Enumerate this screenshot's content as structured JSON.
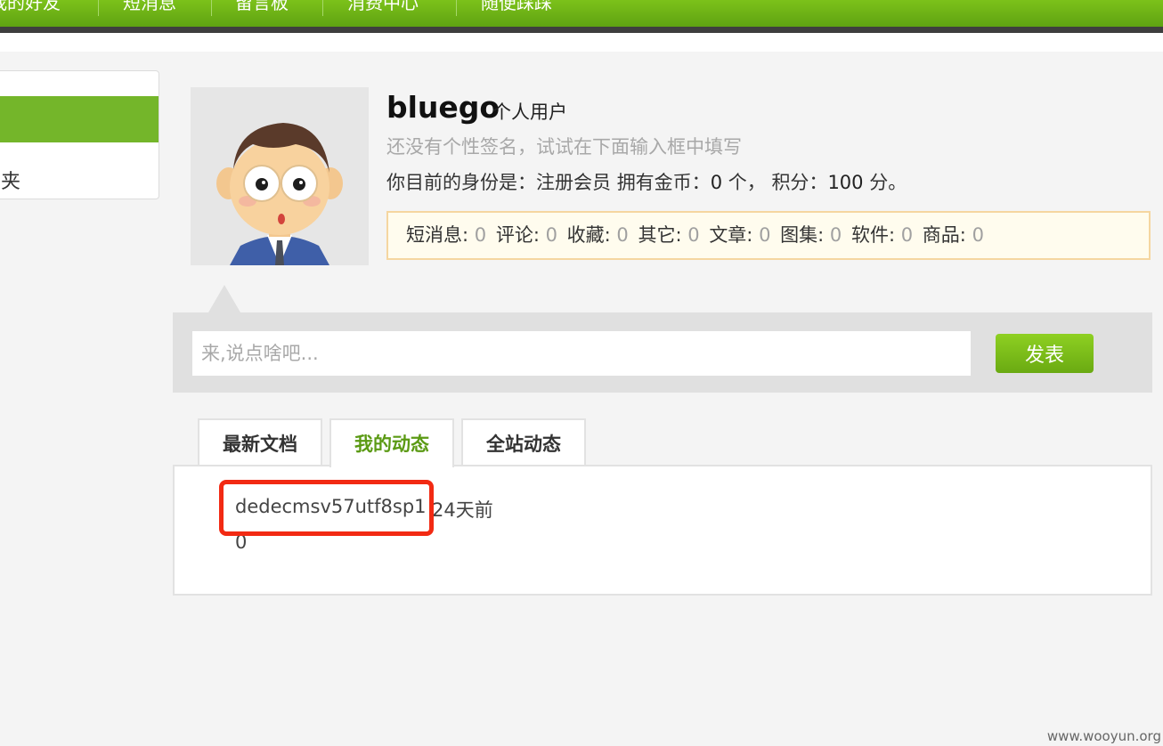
{
  "topnav": {
    "items": [
      "我的好友",
      "短消息",
      "留言板",
      "消费中心",
      "随便踩踩"
    ]
  },
  "sidebar": {
    "partial_label": "夹"
  },
  "profile": {
    "username": "bluego",
    "user_type": "个人用户",
    "signature": "还没有个性签名，试试在下面输入框中填写",
    "identity_prefix": "你目前的身份是：",
    "identity_role": "注册会员",
    "coins_label": "拥有金币：",
    "coins_value": "0",
    "coins_unit": "个，",
    "points_label": "积分：",
    "points_value": "100",
    "points_unit": "分。"
  },
  "stats": [
    {
      "label": "短消息:",
      "value": "0"
    },
    {
      "label": "评论:",
      "value": "0"
    },
    {
      "label": "收藏:",
      "value": "0"
    },
    {
      "label": "其它:",
      "value": "0"
    },
    {
      "label": "文章:",
      "value": "0"
    },
    {
      "label": "图集:",
      "value": "0"
    },
    {
      "label": "软件:",
      "value": "0"
    },
    {
      "label": "商品:",
      "value": "0"
    }
  ],
  "post": {
    "placeholder": "来,说点啥吧...",
    "button_label": "发表"
  },
  "tabs": [
    {
      "label": "最新文档",
      "active": false
    },
    {
      "label": "我的动态",
      "active": true
    },
    {
      "label": "全站动态",
      "active": false
    }
  ],
  "feed": {
    "title": "dedecmsv57utf8sp1",
    "time": "24天前",
    "count": "0"
  },
  "watermark": "www.wooyun.org",
  "colors": {
    "brand_green": "#6aaa12",
    "highlight_red": "#f22a13",
    "stats_border": "#f5d6a0"
  }
}
